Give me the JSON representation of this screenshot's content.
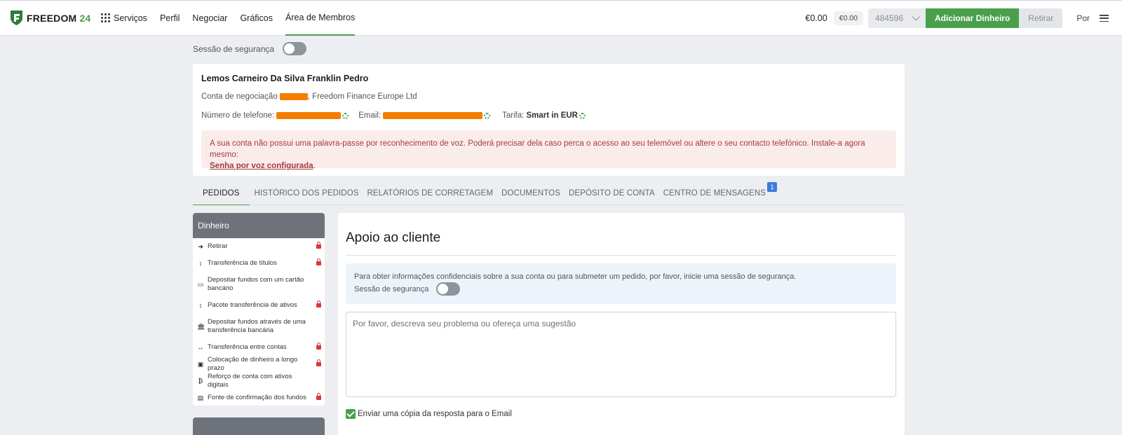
{
  "brand": {
    "name": "FREEDOM",
    "number": "24"
  },
  "nav": {
    "items": [
      {
        "label": "Serviços"
      },
      {
        "label": "Perfil"
      },
      {
        "label": "Negociar"
      },
      {
        "label": "Gráficos"
      },
      {
        "label": "Área de Membros"
      }
    ]
  },
  "toolbar": {
    "balance": "€0.00",
    "balance_small": "€0.00",
    "account_number": "484596",
    "add_money": "Adicionar Dinheiro",
    "withdraw": "Retirar",
    "language": "Por"
  },
  "security": {
    "label": "Sessão de segurança"
  },
  "profile": {
    "name": "Lemos Carneiro Da Silva Franklin Pedro",
    "account_prefix": "Conta de negociação",
    "account_suffix": ", Freedom Finance Europe Ltd",
    "phone_label": "Número de telefone:",
    "email_label": "Email:",
    "tariff_label": "Tarifa:",
    "tariff_value": "Smart in EUR",
    "alert_text": "A sua conta não possui uma palavra-passe por reconhecimento de voz. Poderá precisar dela caso perca o acesso ao seu telemóvel ou altere o seu contacto telefónico. Instale-a agora mesmo:",
    "alert_link": "Senha por voz configurada",
    "alert_end": "."
  },
  "tabs": [
    {
      "label": "PEDIDOS"
    },
    {
      "label": "HISTÓRICO DOS PEDIDOS"
    },
    {
      "label": "RELATÓRIOS DE CORRETAGEM"
    },
    {
      "label": "DOCUMENTOS"
    },
    {
      "label": "DEPÓSITO DE CONTA"
    },
    {
      "label": "CENTRO DE MENSAGENS",
      "badge": "1"
    }
  ],
  "sidebar": {
    "title": "Dinheiro",
    "items": [
      {
        "label": "Retirar",
        "icon": "exit-icon"
      },
      {
        "label": "Transferência de títulos",
        "icon": "transfer-icon"
      },
      {
        "label": "Depositar fundos com um cartão bancário",
        "icon": "card-icon"
      },
      {
        "label": "Pacote transferência de ativos",
        "icon": "transfer-icon"
      },
      {
        "label": "Depositar fundos através de uma transferência bancária",
        "icon": "bank-icon"
      },
      {
        "label": "Transferência entre contas",
        "icon": "arrows-icon"
      },
      {
        "label": "Colocação de dinheiro a longo prazo",
        "icon": "money-icon"
      },
      {
        "label": "Reforço de conta com ativos digitais",
        "icon": "bitcoin-icon"
      },
      {
        "label": "Fonte de confirmação dos fundos",
        "icon": "document-icon"
      }
    ]
  },
  "support": {
    "title": "Apoio ao cliente",
    "info_text": "Para obter informações confidenciais sobre a sua conta ou para submeter um pedido, por favor, inicie uma sessão de segurança.",
    "security_label": "Sessão de segurança",
    "placeholder": "Por favor, descreva seu problema ou ofereça uma sugestão",
    "copy_label": "Enviar uma cópia da resposta para o Email"
  },
  "colors": {
    "accent": "#4a9f4d",
    "alert": "#fbecec",
    "redact": "#f57d00",
    "badge": "#3c7ae0"
  }
}
